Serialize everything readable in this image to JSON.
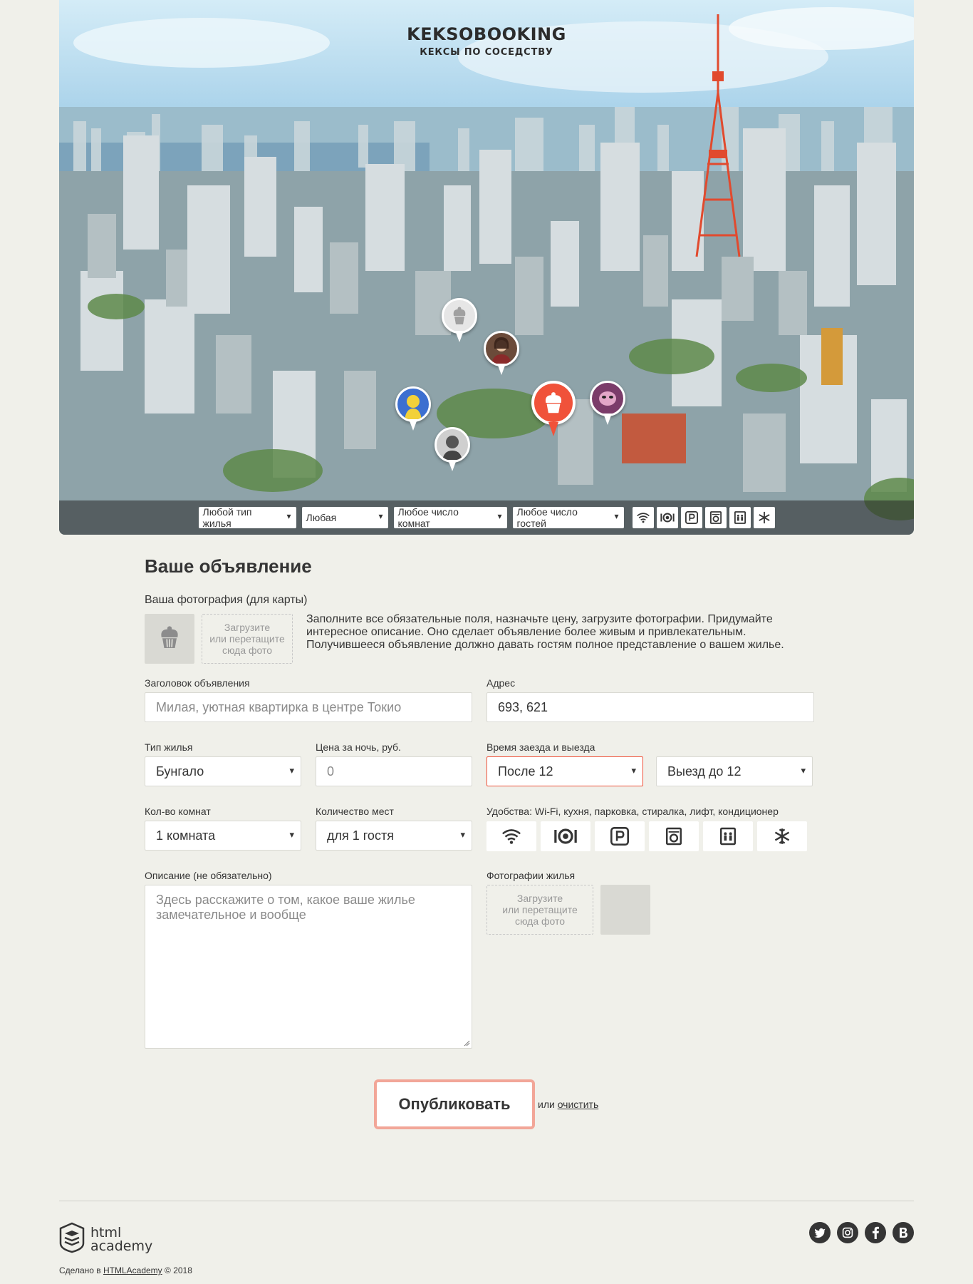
{
  "header": {
    "brand_title": "KEKSOBOOKING",
    "brand_subtitle": "КЕКСЫ ПО СОСЕДСТВУ"
  },
  "filters": {
    "housing_type": "Любой тип жилья",
    "price": "Любая",
    "rooms": "Любое число комнат",
    "guests": "Любое число гостей",
    "features": [
      "wifi-icon",
      "dishwasher-icon",
      "parking-icon",
      "washer-icon",
      "elevator-icon",
      "conditioner-icon"
    ]
  },
  "form": {
    "title": "Ваше объявление",
    "avatar_label": "Ваша фотография (для карты)",
    "avatar_drop": "Загрузите\nили перетащите\nсюда фото",
    "hint": "Заполните все обязательные поля, назначьте цену, загрузите фотографии. Придумайте интересное описание. Оно сделает объявление более живым и привлекательным. Получившееся объявление должно давать гостям полное представление о вашем жилье.",
    "title_label": "Заголовок объявления",
    "title_placeholder": "Милая, уютная квартирка в центре Токио",
    "address_label": "Адрес",
    "address_value": "693, 621",
    "type_label": "Тип жилья",
    "type_value": "Бунгало",
    "price_label": "Цена за ночь, руб.",
    "price_placeholder": "0",
    "time_label": "Время заезда и выезда",
    "checkin_value": "После 12",
    "checkout_value": "Выезд до 12",
    "rooms_label": "Кол-во комнат",
    "rooms_value": "1 комната",
    "capacity_label": "Количество мест",
    "capacity_value": "для 1 гостя",
    "features_label": "Удобства: Wi-Fi, кухня, парковка, стиралка, лифт, кондиционер",
    "description_label": "Описание (не обязательно)",
    "description_placeholder": "Здесь расскажите о том, какое ваше жилье замечательное и вообще",
    "photos_label": "Фотографии жилья",
    "photos_drop": "Загрузите\nили перетащите\nсюда фото",
    "submit_label": "Опубликовать",
    "or_text": "или",
    "reset_label": "очистить"
  },
  "footer": {
    "logo_line1": "html",
    "logo_line2": "academy",
    "copyright_prefix": "Сделано в",
    "copyright_link": "HTMLAcademy",
    "copyright_suffix": "© 2018",
    "social": [
      "twitter-icon",
      "instagram-icon",
      "facebook-icon",
      "vk-icon"
    ]
  },
  "colors": {
    "accent": "#f0523a",
    "page_bg": "#f0f0ea",
    "text": "#353535"
  }
}
